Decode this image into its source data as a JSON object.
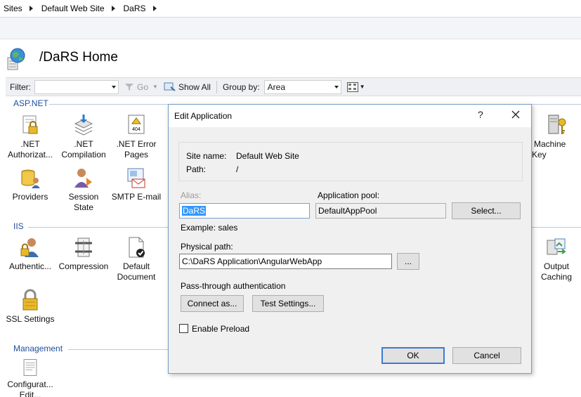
{
  "breadcrumb": {
    "items": [
      "Sites",
      "Default Web Site",
      "DaRS"
    ]
  },
  "page": {
    "title": "/DaRS Home"
  },
  "filterbar": {
    "filter_label": "Filter:",
    "filter_value": "",
    "go_label": "Go",
    "show_all_label": "Show All",
    "group_by_label": "Group by:",
    "group_by_value": "Area"
  },
  "groups": {
    "aspnet": {
      "title": "ASP.NET",
      "items": [
        {
          "label": ".NET Authorizat...",
          "icon": "lock-document-icon"
        },
        {
          "label": ".NET Compilation",
          "icon": "compilation-icon"
        },
        {
          "label": ".NET Error Pages",
          "icon": "error-page-icon",
          "badge": "404"
        },
        {
          "label": "Machine Key",
          "icon": "machine-key-icon"
        },
        {
          "label": "Providers",
          "icon": "providers-icon"
        },
        {
          "label": "Session State",
          "icon": "session-state-icon"
        },
        {
          "label": "SMTP E-mail",
          "icon": "smtp-email-icon"
        }
      ]
    },
    "iis": {
      "title": "IIS",
      "items": [
        {
          "label": "Authentic...",
          "icon": "authentication-icon"
        },
        {
          "label": "Compression",
          "icon": "compression-icon"
        },
        {
          "label": "Default Document",
          "icon": "default-document-icon"
        },
        {
          "label": "Output Caching",
          "icon": "output-caching-icon"
        },
        {
          "label": "SSL Settings",
          "icon": "ssl-lock-icon"
        }
      ]
    },
    "management": {
      "title": "Management",
      "items": [
        {
          "label": "Configurat... Edit...",
          "icon": "configuration-editor-icon"
        }
      ]
    }
  },
  "dialog": {
    "title": "Edit Application",
    "help": "?",
    "site_name_label": "Site name:",
    "site_name_value": "Default Web Site",
    "path_label": "Path:",
    "path_value": "/",
    "alias_label": "Alias:",
    "alias_value": "DaRS",
    "app_pool_label": "Application pool:",
    "app_pool_value": "DefaultAppPool",
    "select_button": "Select...",
    "example_text": "Example: sales",
    "physical_path_label": "Physical path:",
    "physical_path_value": "C:\\DaRS Application\\AngularWebApp",
    "browse_button": "...",
    "passthrough_label": "Pass-through authentication",
    "connect_as_button": "Connect as...",
    "test_settings_button": "Test Settings...",
    "enable_preload_label": "Enable Preload",
    "enable_preload_checked": false,
    "ok_button": "OK",
    "cancel_button": "Cancel"
  },
  "colors": {
    "group_title": "#1f4e9c",
    "dialog_border": "#7a9cc4",
    "default_button_border": "#3a7bd5",
    "selection": "#3399ff"
  }
}
